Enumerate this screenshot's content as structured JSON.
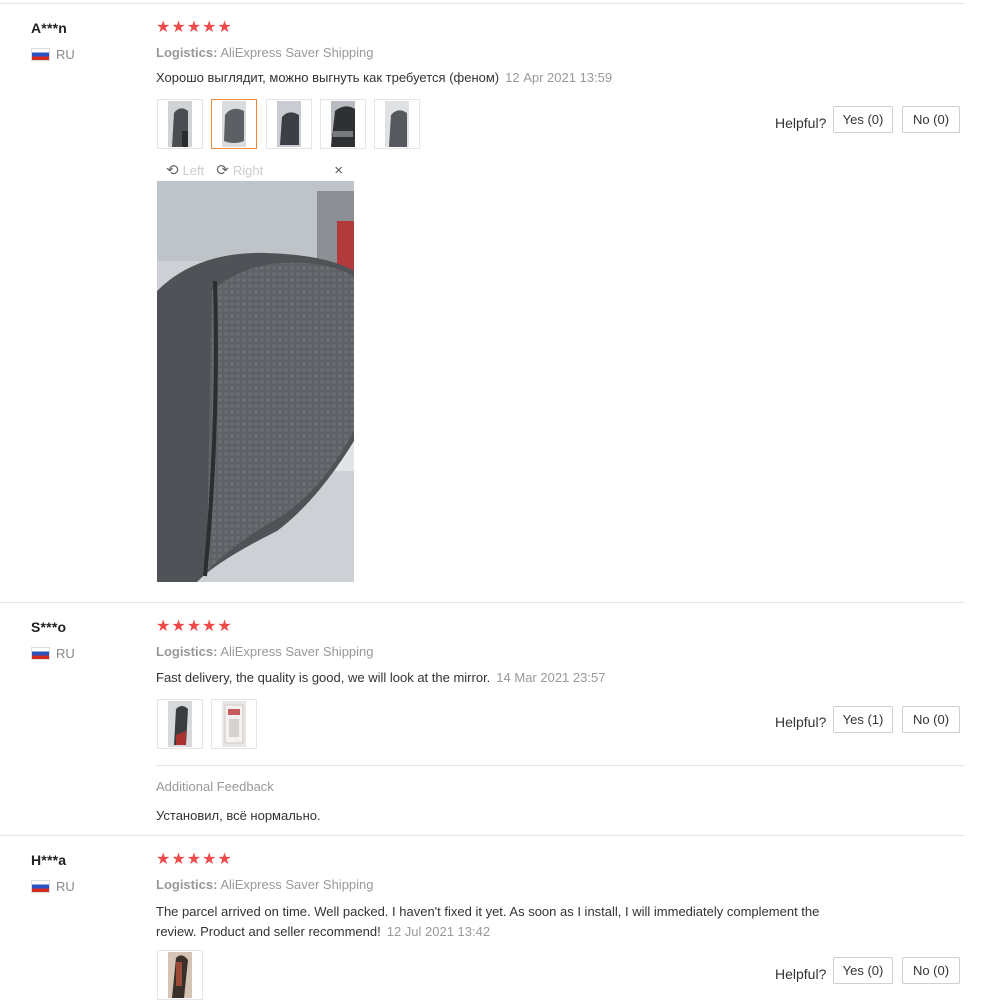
{
  "reviews": [
    {
      "name": "A***n",
      "country": "RU",
      "stars": "★★★★★",
      "logistics_label": "Logistics:",
      "logistics_value": "AliExpress Saver Shipping",
      "text": "Хорошо выглядит, можно выгнуть как требуется (феном)",
      "date": "12 Apr 2021 13:59",
      "helpful_label": "Helpful?",
      "yes_label": "Yes (0)",
      "no_label": "No (0)"
    },
    {
      "name": "S***o",
      "country": "RU",
      "stars": "★★★★★",
      "logistics_label": "Logistics:",
      "logistics_value": "AliExpress Saver Shipping",
      "text": "Fast delivery, the quality is good, we will look at the mirror.",
      "date": "14 Mar 2021 23:57",
      "helpful_label": "Helpful?",
      "yes_label": "Yes (1)",
      "no_label": "No (0)",
      "additional_title": "Additional Feedback",
      "additional_text": "Установил, всё нормально."
    },
    {
      "name": "H***a",
      "country": "RU",
      "stars": "★★★★★",
      "logistics_label": "Logistics:",
      "logistics_value": "AliExpress Saver Shipping",
      "text_line1": "The parcel arrived on time. Well packed. I haven't fixed it yet. As soon as I install, I will immediately complement the",
      "text_line2": "review. Product and seller recommend!",
      "date": "12 Jul 2021 13:42",
      "helpful_label": "Helpful?",
      "yes_label": "Yes (0)",
      "no_label": "No (0)"
    }
  ],
  "viewer": {
    "left_label": "Left",
    "right_label": "Right",
    "close_glyph": "×",
    "rotate_left_glyph": "⟲",
    "rotate_right_glyph": "⟳"
  },
  "colors": {
    "star": "#ef4a4a",
    "active_thumb_border": "#f08a3a"
  }
}
